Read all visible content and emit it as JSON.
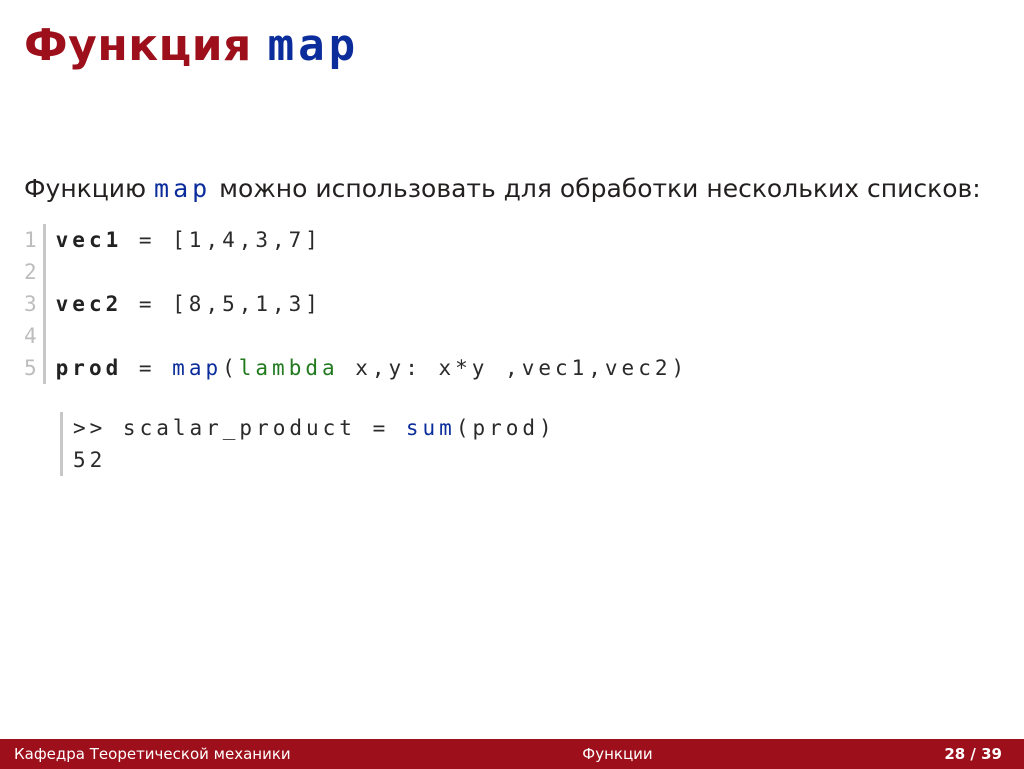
{
  "title": {
    "prefix": "Функция ",
    "code": "map"
  },
  "paragraph": {
    "pre": "Функцию ",
    "code": "map",
    "post": " можно использовать для обработки нескольких списков:"
  },
  "code": {
    "gutter": [
      "1",
      "2",
      "3",
      "4",
      "5"
    ],
    "lines": {
      "l1": {
        "kw": "vec1",
        "rest": " = [1,4,3,7]"
      },
      "l2": "",
      "l3": {
        "kw": "vec2",
        "rest": " = [8,5,1,3]"
      },
      "l4": "",
      "l5": {
        "kw": "prod",
        "eq": " = ",
        "map": "map",
        "open": "(",
        "lambda": "lambda",
        "args": " x,y: x*y ,vec1,vec2)"
      }
    }
  },
  "output": {
    "l1": {
      "prompt": ">> scalar_product = ",
      "sum": "sum",
      "args": "(prod)"
    },
    "l2": "52"
  },
  "footer": {
    "left": "Кафедра Теоретической механики",
    "center": "Функции",
    "page": "28 / 39"
  }
}
